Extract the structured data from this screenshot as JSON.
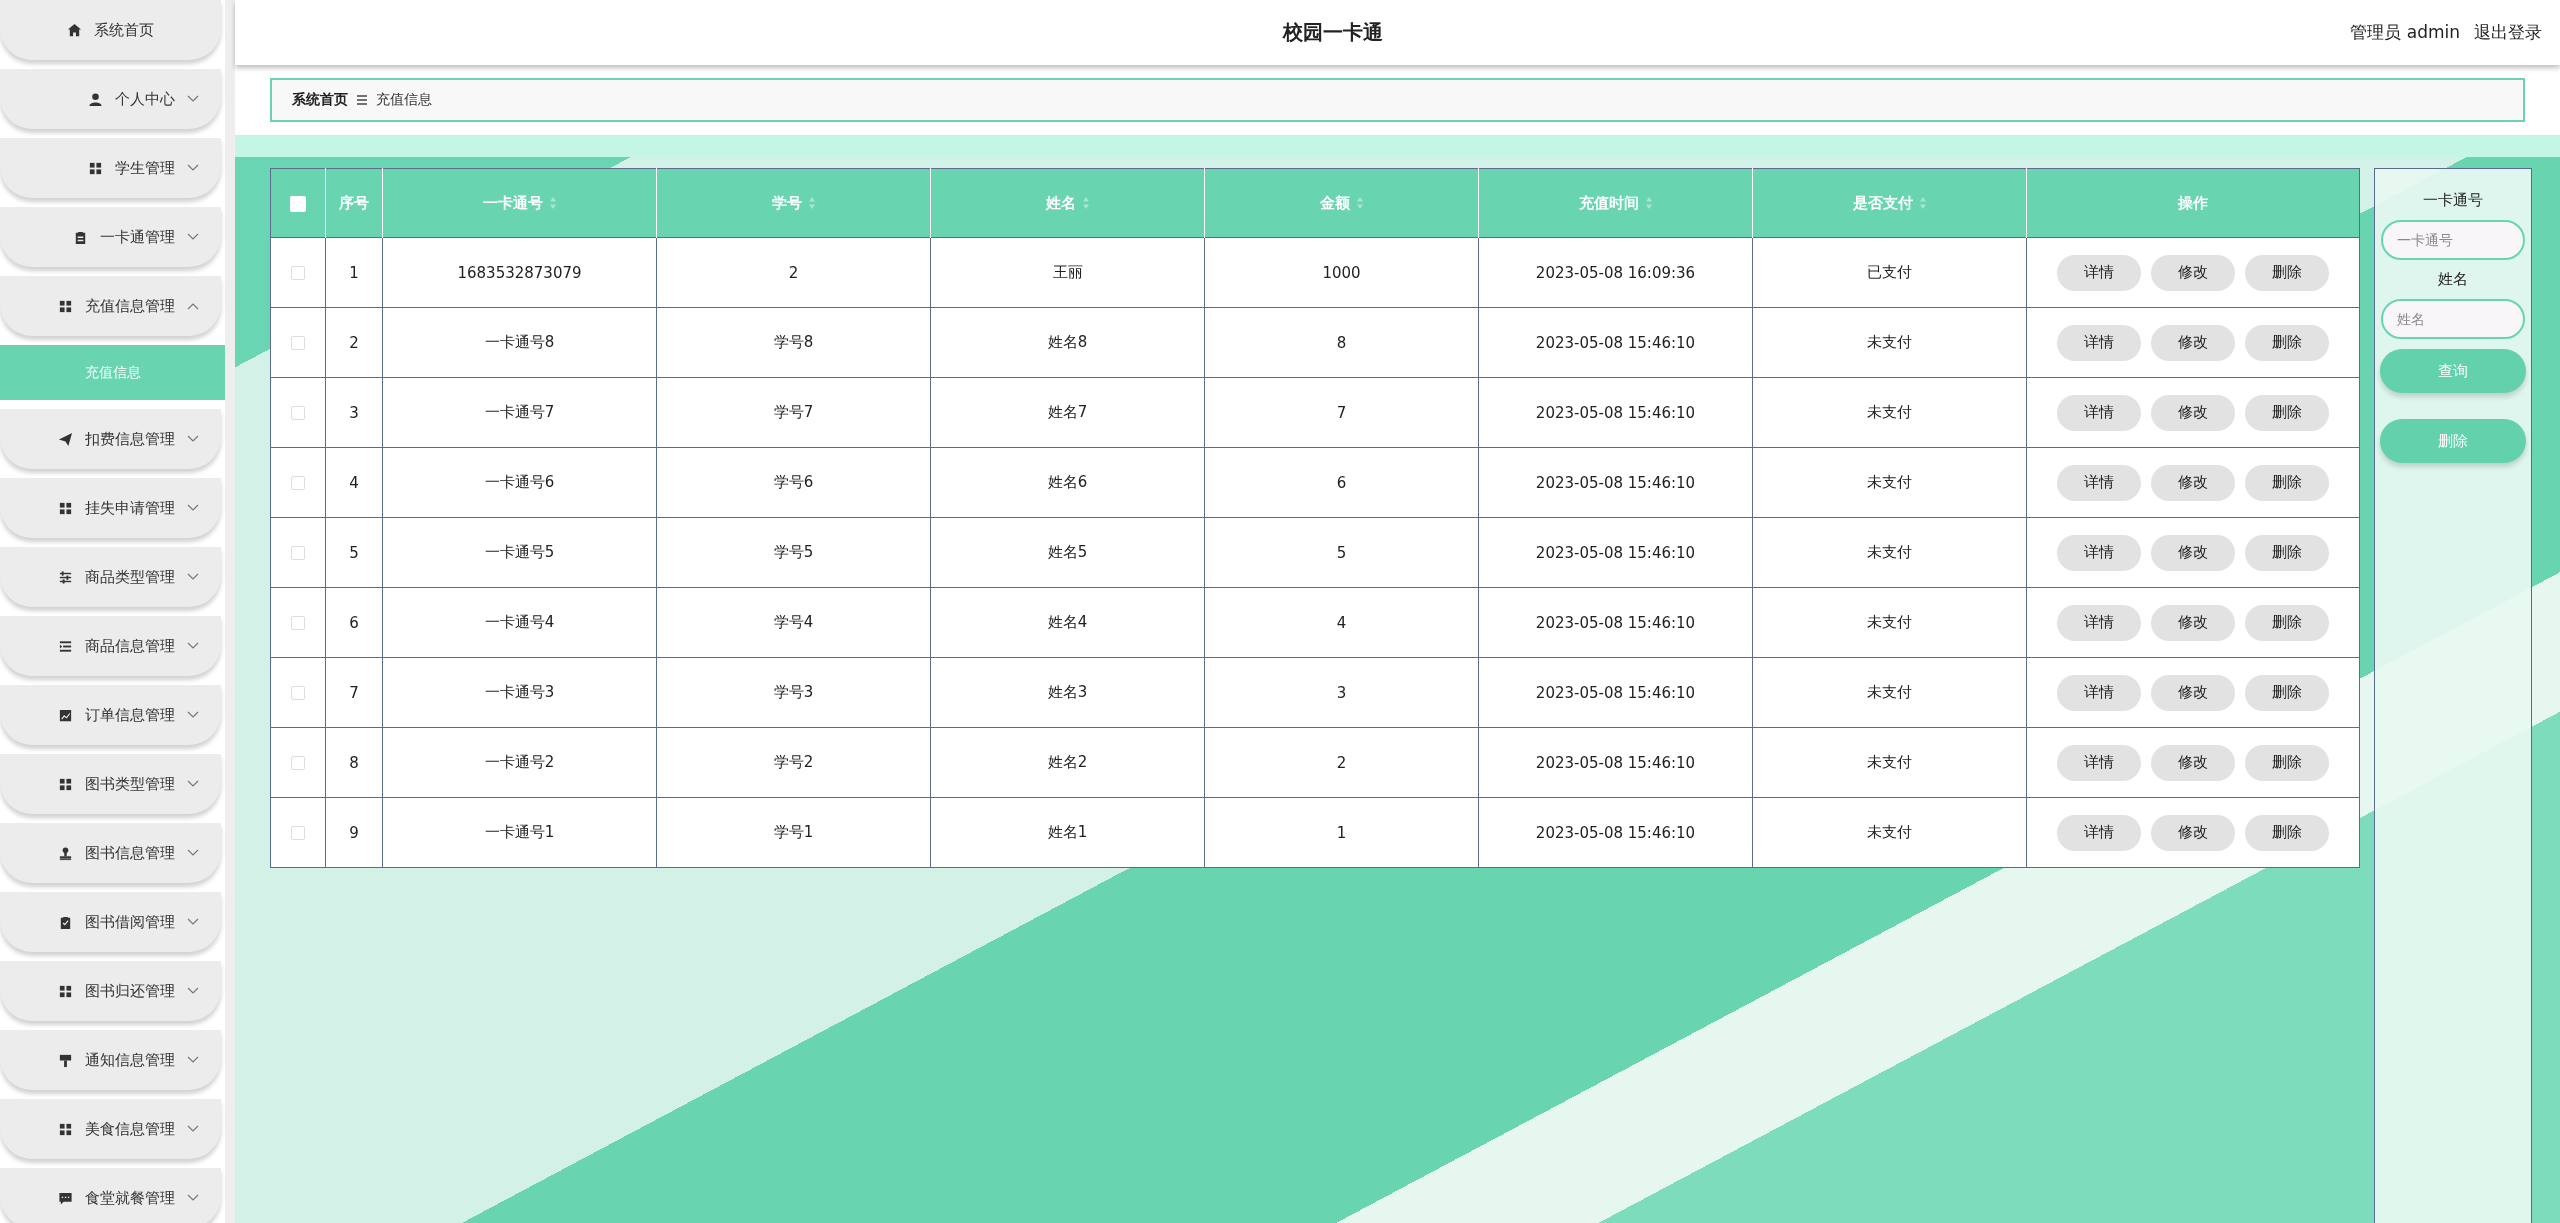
{
  "sidebar": {
    "items": [
      {
        "label": "系统首页",
        "kind": "link"
      },
      {
        "label": "个人中心",
        "kind": "menu",
        "expanded": false
      },
      {
        "label": "学生管理",
        "kind": "menu",
        "expanded": false
      },
      {
        "label": "一卡通管理",
        "kind": "menu",
        "expanded": false
      },
      {
        "label": "充值信息管理",
        "kind": "menu",
        "expanded": true,
        "children": [
          {
            "label": "充值信息",
            "selected": true
          }
        ]
      },
      {
        "label": "扣费信息管理",
        "kind": "menu",
        "expanded": false
      },
      {
        "label": "挂失申请管理",
        "kind": "menu",
        "expanded": false
      },
      {
        "label": "商品类型管理",
        "kind": "menu",
        "expanded": false
      },
      {
        "label": "商品信息管理",
        "kind": "menu",
        "expanded": false
      },
      {
        "label": "订单信息管理",
        "kind": "menu",
        "expanded": false
      },
      {
        "label": "图书类型管理",
        "kind": "menu",
        "expanded": false
      },
      {
        "label": "图书信息管理",
        "kind": "menu",
        "expanded": false
      },
      {
        "label": "图书借阅管理",
        "kind": "menu",
        "expanded": false
      },
      {
        "label": "图书归还管理",
        "kind": "menu",
        "expanded": false
      },
      {
        "label": "通知信息管理",
        "kind": "menu",
        "expanded": false
      },
      {
        "label": "美食信息管理",
        "kind": "menu",
        "expanded": false
      },
      {
        "label": "食堂就餐管理",
        "kind": "menu",
        "expanded": false
      }
    ]
  },
  "header": {
    "title": "校园一卡通",
    "user": "管理员 admin",
    "logout": "退出登录"
  },
  "breadcrumb": [
    "系统首页",
    "充值信息"
  ],
  "table": {
    "select_all": {
      "checked": false
    },
    "columns": [
      {
        "label": "序号",
        "sortable": false
      },
      {
        "label": "一卡通号",
        "sortable": true
      },
      {
        "label": "学号",
        "sortable": true
      },
      {
        "label": "姓名",
        "sortable": true
      },
      {
        "label": "金额",
        "sortable": true
      },
      {
        "label": "充值时间",
        "sortable": true
      },
      {
        "label": "是否支付",
        "sortable": true
      },
      {
        "label": "操作",
        "sortable": false
      }
    ],
    "rows": [
      {
        "checked": false,
        "cells": [
          "1",
          "1683532873079",
          "2",
          "王丽",
          "1000",
          "2023-05-08 16:09:36",
          "已支付"
        ],
        "actions": [
          "详情",
          "修改",
          "删除"
        ]
      },
      {
        "checked": false,
        "cells": [
          "2",
          "一卡通号8",
          "学号8",
          "姓名8",
          "8",
          "2023-05-08 15:46:10",
          "未支付"
        ],
        "actions": [
          "详情",
          "修改",
          "删除"
        ]
      },
      {
        "checked": false,
        "cells": [
          "3",
          "一卡通号7",
          "学号7",
          "姓名7",
          "7",
          "2023-05-08 15:46:10",
          "未支付"
        ],
        "actions": [
          "详情",
          "修改",
          "删除"
        ]
      },
      {
        "checked": false,
        "cells": [
          "4",
          "一卡通号6",
          "学号6",
          "姓名6",
          "6",
          "2023-05-08 15:46:10",
          "未支付"
        ],
        "actions": [
          "详情",
          "修改",
          "删除"
        ]
      },
      {
        "checked": false,
        "cells": [
          "5",
          "一卡通号5",
          "学号5",
          "姓名5",
          "5",
          "2023-05-08 15:46:10",
          "未支付"
        ],
        "actions": [
          "详情",
          "修改",
          "删除"
        ]
      },
      {
        "checked": false,
        "cells": [
          "6",
          "一卡通号4",
          "学号4",
          "姓名4",
          "4",
          "2023-05-08 15:46:10",
          "未支付"
        ],
        "actions": [
          "详情",
          "修改",
          "删除"
        ]
      },
      {
        "checked": false,
        "cells": [
          "7",
          "一卡通号3",
          "学号3",
          "姓名3",
          "3",
          "2023-05-08 15:46:10",
          "未支付"
        ],
        "actions": [
          "详情",
          "修改",
          "删除"
        ]
      },
      {
        "checked": false,
        "cells": [
          "8",
          "一卡通号2",
          "学号2",
          "姓名2",
          "2",
          "2023-05-08 15:46:10",
          "未支付"
        ],
        "actions": [
          "详情",
          "修改",
          "删除"
        ]
      },
      {
        "checked": false,
        "cells": [
          "9",
          "一卡通号1",
          "学号1",
          "姓名1",
          "1",
          "2023-05-08 15:46:10",
          "未支付"
        ],
        "actions": [
          "详情",
          "修改",
          "删除"
        ]
      }
    ]
  },
  "search": {
    "fields": [
      {
        "label": "一卡通号",
        "placeholder": "一卡通号"
      },
      {
        "label": "姓名",
        "placeholder": "姓名"
      }
    ],
    "buttons": [
      "查询",
      "删除"
    ]
  }
}
